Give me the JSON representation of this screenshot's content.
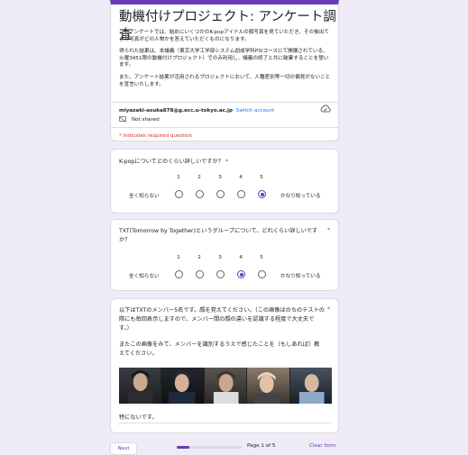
{
  "form": {
    "title": "動機付けプロジェクト: アンケート調査",
    "description": [
      "このアンケートでは、始めにいくつかのK-popアイドルの顔写真を見ていただき、その後出てきた写真がどの人物かを答えていただくものになります。",
      "得られた結果は、本議義（東京大学工学部システム創成学科PSIコースにて開講されている、火曜3451限の動機付けプロジェクト）でのみ利用し、議義の終了と共に破棄することを誓います。",
      "また、アンケート結果が活用されるプロジェクトにおいて、人種差別等一切の偏見がないことを宣言いたします。"
    ],
    "account_email": "miyazaki-asuka878@g.ecc.u-tokyo.ac.jp",
    "switch_account": "Switch account",
    "not_shared": "Not shared",
    "required_note": "* Indicates required question"
  },
  "questions": [
    {
      "text": "K-popについてどのくらい詳しいですか？",
      "required": "*",
      "scale": [
        "1",
        "2",
        "3",
        "4",
        "5"
      ],
      "low_label": "全く知らない",
      "high_label": "かなり知っている",
      "selected": 5
    },
    {
      "text": "TXT(Tomorrow by Together)というグループについて、どれくらい詳しいですか？",
      "required": "*",
      "scale": [
        "1",
        "2",
        "3",
        "4",
        "5"
      ],
      "low_label": "全く知らない",
      "high_label": "かなり知っている",
      "selected": 4
    },
    {
      "text": "以下はTXTのメンバー5名です。顔を覚えてください。（この画像はのちのテストの際にも毎回表示しますので、メンバー間の顔の違いを認識する程度で大丈夫です。）",
      "text2": "またこの画像をみて、メンバーを識別するうえで感じたことを（もしあれば）教えてください。",
      "required": "*",
      "answer": "特にないです。"
    }
  ],
  "footer": {
    "next_label": "Next",
    "page_indicator": "Page 1 of 5",
    "clear_label": "Clear form",
    "progress": 0.2
  },
  "colors": {
    "accent": "#673ab7",
    "required": "#d93025",
    "link": "#1a73e8",
    "background": "#efebf7"
  }
}
